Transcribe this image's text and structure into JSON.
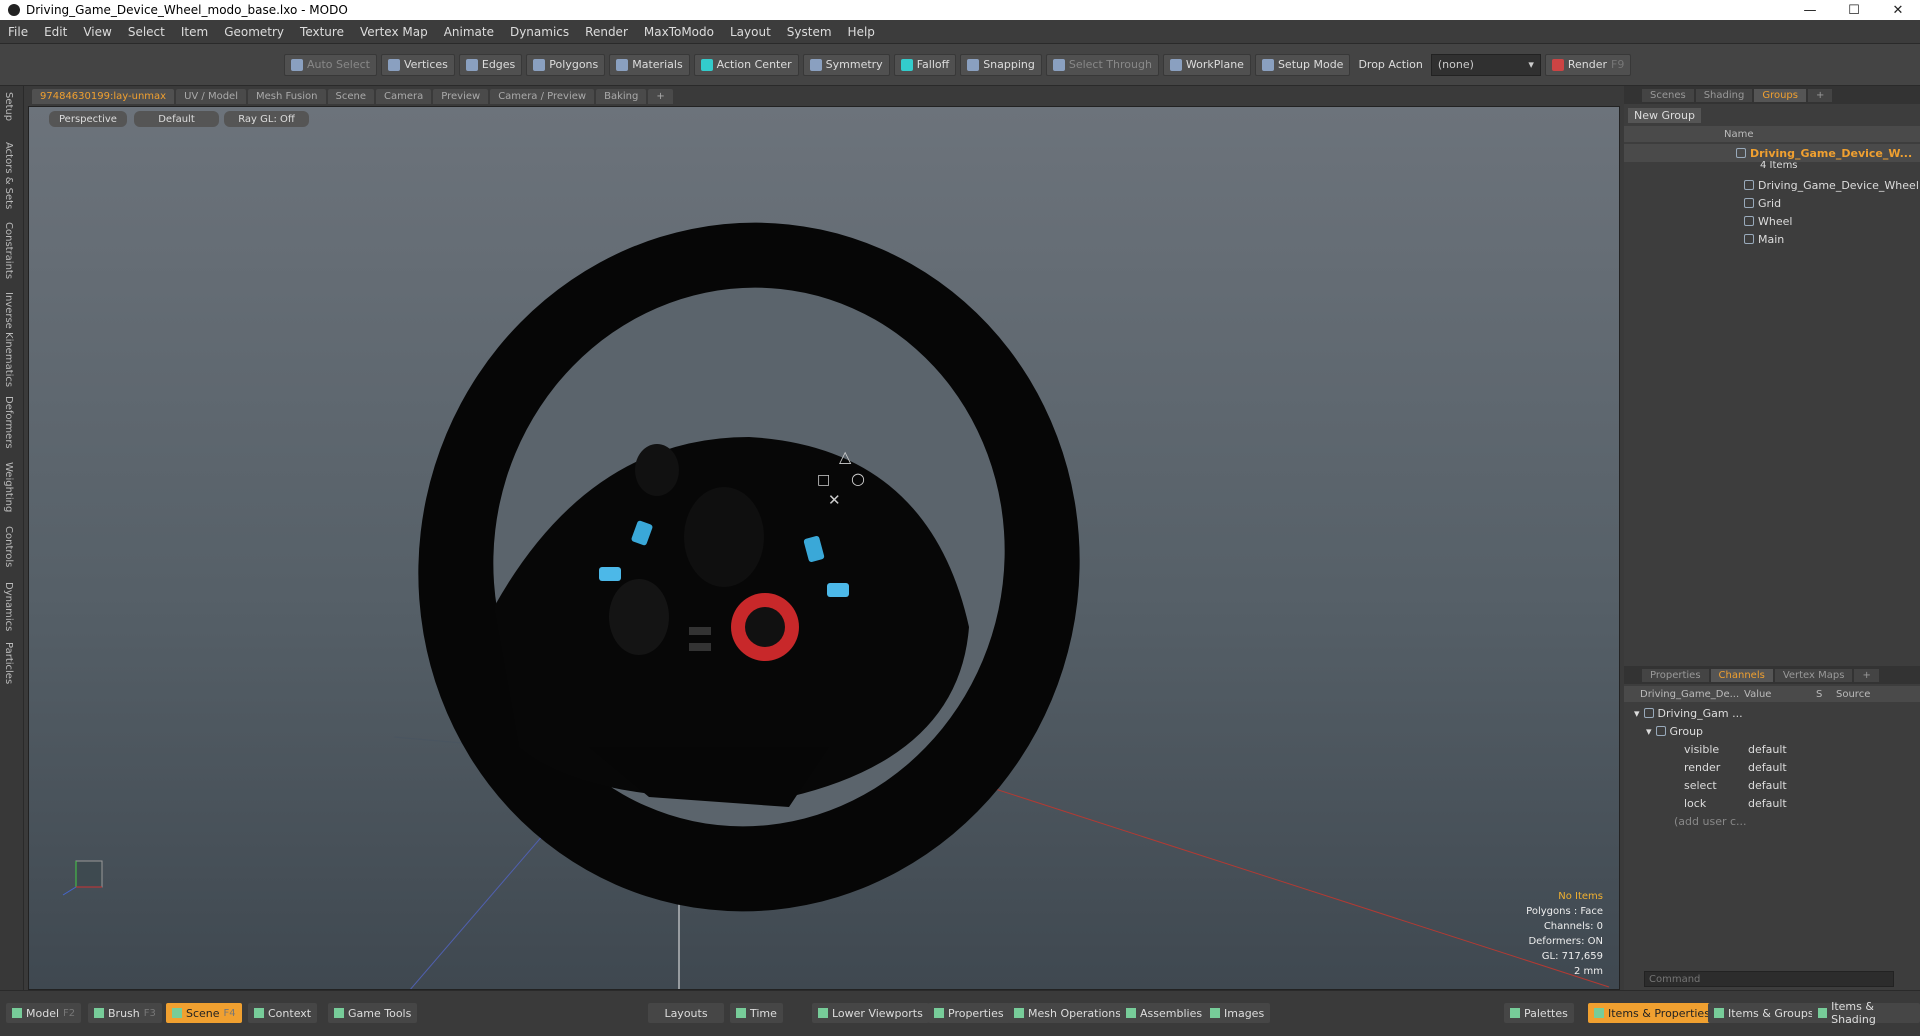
{
  "window": {
    "title": "Driving_Game_Device_Wheel_modo_base.lxo - MODO",
    "minimize": "—",
    "maximize": "☐",
    "close": "✕"
  },
  "menu": [
    "File",
    "Edit",
    "View",
    "Select",
    "Item",
    "Geometry",
    "Texture",
    "Vertex Map",
    "Animate",
    "Dynamics",
    "Render",
    "MaxToModo",
    "Layout",
    "System",
    "Help"
  ],
  "toolbar": {
    "auto_select": "Auto Select",
    "vertices": "Vertices",
    "edges": "Edges",
    "polygons": "Polygons",
    "materials": "Materials",
    "action_center": "Action Center",
    "symmetry": "Symmetry",
    "falloff": "Falloff",
    "snapping": "Snapping",
    "select_through": "Select Through",
    "workplane": "WorkPlane",
    "setup_mode": "Setup Mode",
    "drop_action": "Drop Action",
    "drop_value": "(none)",
    "render": "Render",
    "render_key": "F9"
  },
  "left_tabs": [
    "Setup",
    "Actors & Sets",
    "Constraints",
    "Inverse Kinematics",
    "Deformers",
    "Weighting",
    "Controls",
    "Dynamics",
    "Particles"
  ],
  "viewport_tabs": [
    "97484630199:lay-unmax",
    "UV / Model",
    "Mesh Fusion",
    "Scene",
    "Camera",
    "Preview",
    "Camera / Preview",
    "Baking",
    "+"
  ],
  "viewport": {
    "perspective": "Perspective",
    "shading": "Default",
    "raygl": "Ray GL: Off"
  },
  "hud": {
    "items": "No Items",
    "polygons": "Polygons : Face",
    "channels": "Channels: 0",
    "deformers": "Deformers: ON",
    "gl": "GL: 717,659",
    "scale": "2 mm"
  },
  "right_top_tabs": [
    "Scenes",
    "Shading",
    "Groups",
    "+"
  ],
  "groups": {
    "new_group": "New Group",
    "name_col": "Name",
    "root": "Driving_Game_Device_W...",
    "root_sub": "4 Items",
    "children": [
      "Driving_Game_Device_Wheel",
      "Grid",
      "Wheel",
      "Main"
    ]
  },
  "right_bottom_tabs": [
    "Properties",
    "Channels",
    "Vertex Maps",
    "+"
  ],
  "channels": {
    "col_name": "Driving_Game_De...",
    "col_value": "Value",
    "col_s": "S",
    "col_source": "Source",
    "item": "Driving_Gam ...",
    "group": "Group",
    "rows": [
      {
        "name": "visible",
        "value": "default"
      },
      {
        "name": "render",
        "value": "default"
      },
      {
        "name": "select",
        "value": "default"
      },
      {
        "name": "lock",
        "value": "default"
      }
    ],
    "add_user": "(add user c..."
  },
  "command_placeholder": "Command",
  "bottom": {
    "model": "Model",
    "model_key": "F2",
    "brush": "Brush",
    "brush_key": "F3",
    "scene": "Scene",
    "scene_key": "F4",
    "context": "Context",
    "game_tools": "Game Tools",
    "layouts": "Layouts",
    "time": "Time",
    "lower_viewports": "Lower Viewports",
    "properties": "Properties",
    "mesh_operations": "Mesh Operations",
    "assemblies": "Assemblies",
    "images": "Images",
    "palettes": "Palettes",
    "items_properties": "Items & Properties",
    "items_groups": "Items & Groups",
    "items_shading": "Items & Shading"
  },
  "colors": {
    "accent": "#f0a030",
    "wheel_button": "#3aa8d8",
    "wheel_dial": "#c8282a"
  }
}
